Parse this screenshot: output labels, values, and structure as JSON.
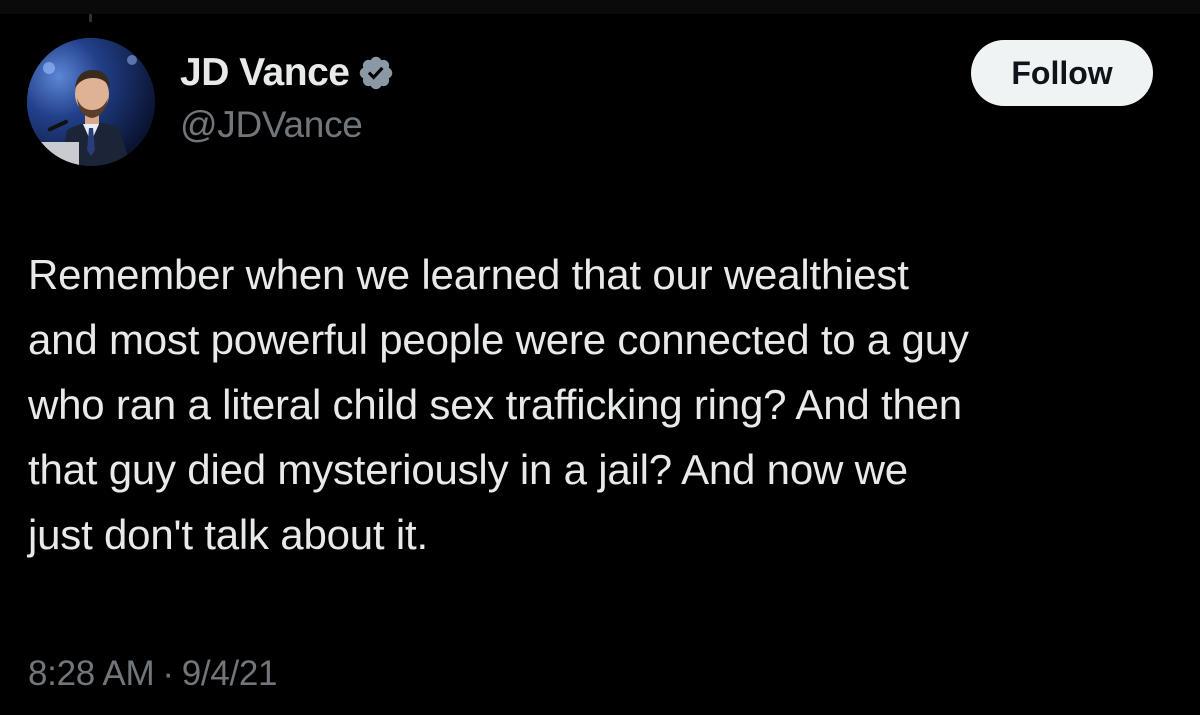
{
  "author": {
    "display_name": "JD Vance",
    "handle": "@JDVance",
    "verified_icon": "verified-badge-icon",
    "avatar": "profile-photo"
  },
  "actions": {
    "follow_label": "Follow"
  },
  "tweet": {
    "text": "Remember when we learned that our wealthiest\nand most powerful people were connected to a guy\nwho ran a literal child sex trafficking ring? And then\nthat guy died mysteriously in a jail? And now we\njust don't talk about it.",
    "time": "8:28 AM",
    "separator": "·",
    "date": "9/4/21"
  },
  "colors": {
    "background": "#000000",
    "primary_text": "#e7e9ea",
    "secondary_text": "#71767b",
    "follow_button_bg": "#eff3f4",
    "follow_button_text": "#0f1419",
    "verified_badge": "#8b98a5"
  }
}
